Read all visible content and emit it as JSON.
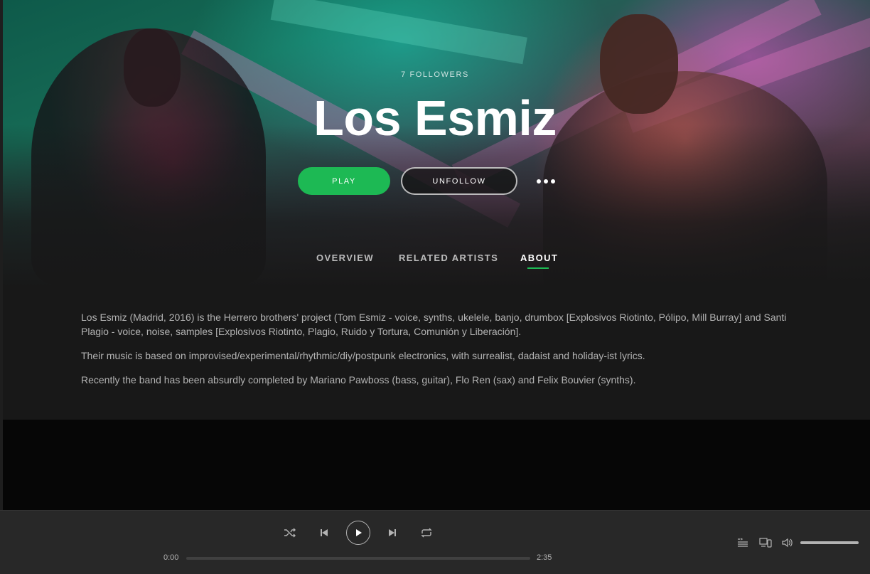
{
  "artist": {
    "followers": "7 FOLLOWERS",
    "name": "Los Esmiz"
  },
  "actions": {
    "play_label": "PLAY",
    "unfollow_label": "UNFOLLOW",
    "more_icon": "more-dots-icon"
  },
  "tabs": [
    {
      "label": "OVERVIEW",
      "active": false
    },
    {
      "label": "RELATED ARTISTS",
      "active": false
    },
    {
      "label": "ABOUT",
      "active": true
    }
  ],
  "about": {
    "paragraphs": [
      "Los Esmiz (Madrid, 2016) is the Herrero brothers' project (Tom Esmiz - voice, synths, ukelele, banjo, drumbox [Explosivos Riotinto, Pólipo, Mill Burray] and Santi Plagio - voice, noise, samples [Explosivos Riotinto, Plagio, Ruido y Tortura, Comunión y Liberación].",
      "Their music is based on improvised/experimental/rhythmic/diy/postpunk electronics, with surrealist, dadaist and holiday-ist lyrics.",
      "Recently the band has been absurdly completed by Mariano Pawboss (bass, guitar), Flo Ren (sax) and Felix Bouvier (synths)."
    ]
  },
  "player": {
    "time_current": "0:00",
    "time_total": "2:35",
    "progress_fraction": 0,
    "volume_fraction": 1.0,
    "icons": [
      "shuffle-icon",
      "previous-icon",
      "play-icon",
      "next-icon",
      "repeat-icon",
      "queue-icon",
      "devices-icon",
      "volume-icon"
    ]
  },
  "colors": {
    "accent": "#1db954",
    "background": "#181818",
    "player_bg": "#282828",
    "text_muted": "#b3b3b3"
  }
}
